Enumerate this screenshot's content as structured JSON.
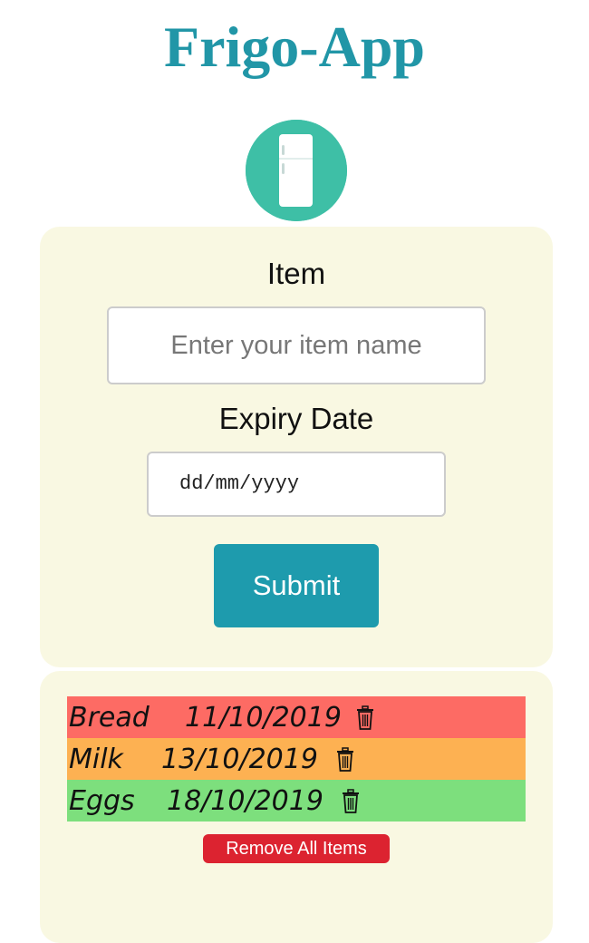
{
  "app": {
    "title": "Frigo-App"
  },
  "colors": {
    "title": "#2196a7",
    "logo_bg": "#3ebfa6",
    "panel_bg": "#f9f8e2",
    "submit_bg": "#1e9bad",
    "expired": "#fd6b64",
    "soon": "#fdb152",
    "fresh": "#7ddf7d",
    "remove_bg": "#dc2330"
  },
  "logo": {
    "icon": "fridge-icon"
  },
  "form": {
    "item_label": "Item",
    "item_placeholder": "Enter your item name",
    "item_value": "",
    "date_label": "Expiry Date",
    "date_placeholder": "dd/mm/yyyy",
    "submit_label": "Submit"
  },
  "items": [
    {
      "name": "Bread",
      "date": "11/10/2019",
      "status": "expired",
      "icon": "trash-icon"
    },
    {
      "name": "Milk",
      "date": "13/10/2019",
      "status": "soon",
      "icon": "trash-icon"
    },
    {
      "name": "Eggs",
      "date": "18/10/2019",
      "status": "fresh",
      "icon": "trash-icon"
    }
  ],
  "remove_all_label": "Remove All Items"
}
